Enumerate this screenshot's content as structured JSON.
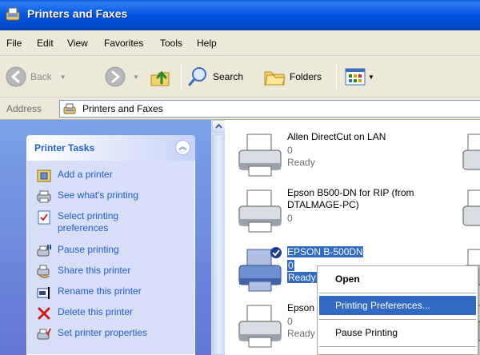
{
  "window": {
    "title": "Printers and Faxes",
    "icon": "printers-folder-icon"
  },
  "menu": [
    "File",
    "Edit",
    "View",
    "Favorites",
    "Tools",
    "Help"
  ],
  "toolbar": {
    "back_label": "Back",
    "search_label": "Search",
    "folders_label": "Folders"
  },
  "address": {
    "label": "Address",
    "value": "Printers and Faxes"
  },
  "task_pane": {
    "title": "Printer Tasks",
    "items": [
      {
        "label": "Add a printer",
        "icon": "add-printer-icon"
      },
      {
        "label": "See what's printing",
        "icon": "print-queue-icon"
      },
      {
        "label": "Select printing preferences",
        "icon": "preferences-icon"
      },
      {
        "label": "Pause printing",
        "icon": "pause-printer-icon"
      },
      {
        "label": "Share this printer",
        "icon": "share-printer-icon"
      },
      {
        "label": "Rename this printer",
        "icon": "rename-icon"
      },
      {
        "label": "Delete this printer",
        "icon": "delete-x-icon"
      },
      {
        "label": "Set printer properties",
        "icon": "printer-properties-icon"
      }
    ]
  },
  "printers": [
    {
      "name": "Allen DirectCut on LAN",
      "count": "0",
      "status": "Ready",
      "selected": false
    },
    {
      "name": "Epson B500-DN for RIP (from DTALMAGE-PC)",
      "count": "0",
      "status": "",
      "selected": false
    },
    {
      "name": "EPSON B-500DN",
      "count": "0",
      "status": "Ready",
      "selected": true
    },
    {
      "name": "Epson",
      "count": "0",
      "status": "Ready",
      "selected": false
    }
  ],
  "context_menu": {
    "items": [
      "Open",
      "Printing Preferences...",
      "Pause Printing"
    ],
    "default": "Open",
    "highlighted": "Printing Preferences..."
  },
  "colors": {
    "selection": "#316ac5",
    "link": "#215dc6",
    "titlebar": "#0054e3"
  }
}
